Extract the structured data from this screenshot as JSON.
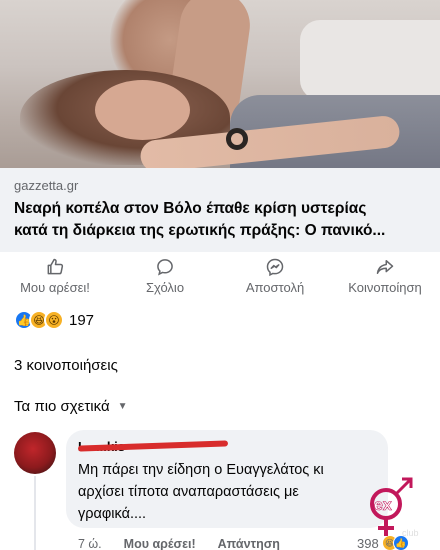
{
  "post": {
    "link": {
      "source": "gazzetta.gr",
      "headline_line1": "Νεαρή κοπέλα στον Βόλο έπαθε κρίση υστερίας",
      "headline_line2": "κατά τη διάρκεια της ερωτικής πράξης: Ο πανικό..."
    },
    "actions": [
      {
        "label": "Μου αρέσει!",
        "icon": "like-icon"
      },
      {
        "label": "Σχόλιο",
        "icon": "comment-icon"
      },
      {
        "label": "Αποστολή",
        "icon": "messenger-icon"
      },
      {
        "label": "Κοινοποίηση",
        "icon": "share-icon"
      }
    ],
    "reactions": {
      "count": "197",
      "types": [
        "like",
        "haha",
        "wow"
      ]
    },
    "shares_text": "3 κοινοποιήσεις",
    "sort_label": "Τα πιο σχετικά"
  },
  "comment": {
    "author_visible": "Ι... ...kis",
    "line1": "Μη πάρει την είδηση ο Ευαγγελάτος κι",
    "line2": "αρχίσει τίποτα αναπαραστάσεις με",
    "line3": "γραφικά....",
    "time": "7 ώ.",
    "like_label": "Μου αρέσει!",
    "reply_label": "Απάντηση",
    "reaction_count": "398"
  },
  "colors": {
    "facebook_blue": "#1877f2",
    "muted_text": "#65676b",
    "link_box_bg": "#f0f2f5",
    "redaction": "#d82c2c",
    "watermark": "#c2185b"
  },
  "watermark_text": "Sex Club"
}
